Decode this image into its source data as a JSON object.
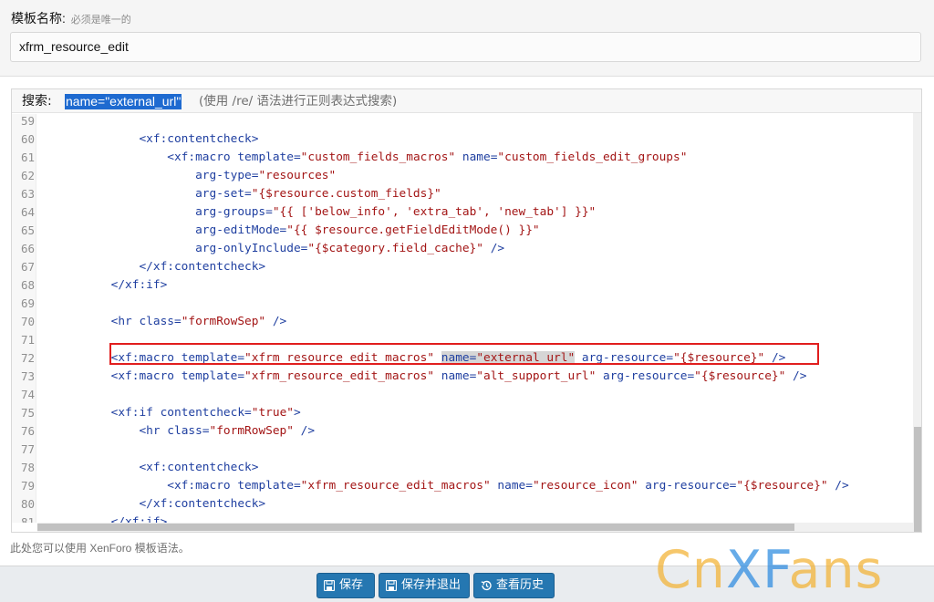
{
  "form": {
    "title_label": "模板名称:",
    "title_hint": "必须是唯一的",
    "title_value": "xfrm_resource_edit",
    "explain": "此处您可以使用 XenForo 模板语法。"
  },
  "editor": {
    "search_label": "搜索:",
    "search_value": "name=\"external_url\"",
    "search_hint": "(使用 /re/ 语法进行正则表达式搜索)",
    "partial_line": "82",
    "lines": [
      {
        "n": "59",
        "segs": []
      },
      {
        "n": "60",
        "segs": [
          {
            "c": "t",
            "v": "            <xf:contentcheck>"
          }
        ]
      },
      {
        "n": "61",
        "segs": [
          {
            "c": "t",
            "v": "                <xf:macro "
          },
          {
            "c": "a",
            "v": "template="
          },
          {
            "c": "s",
            "v": "\"custom_fields_macros\""
          },
          {
            "c": "a",
            "v": " name="
          },
          {
            "c": "s",
            "v": "\"custom_fields_edit_groups\""
          }
        ]
      },
      {
        "n": "62",
        "segs": [
          {
            "c": "a",
            "v": "                    arg-type="
          },
          {
            "c": "s",
            "v": "\"resources\""
          }
        ]
      },
      {
        "n": "63",
        "segs": [
          {
            "c": "a",
            "v": "                    arg-set="
          },
          {
            "c": "s",
            "v": "\"{$resource.custom_fields}\""
          }
        ]
      },
      {
        "n": "64",
        "segs": [
          {
            "c": "a",
            "v": "                    arg-groups="
          },
          {
            "c": "s",
            "v": "\"{{ ['below_info', 'extra_tab', 'new_tab'] }}\""
          }
        ]
      },
      {
        "n": "65",
        "segs": [
          {
            "c": "a",
            "v": "                    arg-editMode="
          },
          {
            "c": "s",
            "v": "\"{{ $resource.getFieldEditMode() }}\""
          }
        ]
      },
      {
        "n": "66",
        "segs": [
          {
            "c": "a",
            "v": "                    arg-onlyInclude="
          },
          {
            "c": "s",
            "v": "\"{$category.field_cache}\""
          },
          {
            "c": "t",
            "v": " />"
          }
        ]
      },
      {
        "n": "67",
        "segs": [
          {
            "c": "t",
            "v": "            </xf:contentcheck>"
          }
        ]
      },
      {
        "n": "68",
        "segs": [
          {
            "c": "t",
            "v": "        </xf:if>"
          }
        ]
      },
      {
        "n": "69",
        "segs": []
      },
      {
        "n": "70",
        "segs": [
          {
            "c": "t",
            "v": "        <hr "
          },
          {
            "c": "a",
            "v": "class="
          },
          {
            "c": "s",
            "v": "\"formRowSep\""
          },
          {
            "c": "t",
            "v": " />"
          }
        ]
      },
      {
        "n": "71",
        "segs": []
      },
      {
        "n": "72",
        "segs": [
          {
            "c": "t",
            "v": "        <xf:macro "
          },
          {
            "c": "a",
            "v": "template="
          },
          {
            "c": "s",
            "v": "\"xfrm_resource_edit_macros\""
          },
          {
            "c": "p",
            "v": " "
          },
          {
            "c": "a hl-match",
            "v": "name="
          },
          {
            "c": "s hl-match",
            "v": "\"external_url\""
          },
          {
            "c": "a",
            "v": " arg-resource="
          },
          {
            "c": "s",
            "v": "\"{$resource}\""
          },
          {
            "c": "t",
            "v": " />"
          }
        ]
      },
      {
        "n": "73",
        "segs": [
          {
            "c": "t",
            "v": "        <xf:macro "
          },
          {
            "c": "a",
            "v": "template="
          },
          {
            "c": "s",
            "v": "\"xfrm_resource_edit_macros\""
          },
          {
            "c": "a",
            "v": " name="
          },
          {
            "c": "s",
            "v": "\"alt_support_url\""
          },
          {
            "c": "a",
            "v": " arg-resource="
          },
          {
            "c": "s",
            "v": "\"{$resource}\""
          },
          {
            "c": "t",
            "v": " />"
          }
        ]
      },
      {
        "n": "74",
        "segs": []
      },
      {
        "n": "75",
        "segs": [
          {
            "c": "t",
            "v": "        <xf:if "
          },
          {
            "c": "a",
            "v": "contentcheck="
          },
          {
            "c": "s",
            "v": "\"true\""
          },
          {
            "c": "t",
            "v": ">"
          }
        ]
      },
      {
        "n": "76",
        "segs": [
          {
            "c": "t",
            "v": "            <hr "
          },
          {
            "c": "a",
            "v": "class="
          },
          {
            "c": "s",
            "v": "\"formRowSep\""
          },
          {
            "c": "t",
            "v": " />"
          }
        ]
      },
      {
        "n": "77",
        "segs": []
      },
      {
        "n": "78",
        "segs": [
          {
            "c": "t",
            "v": "            <xf:contentcheck>"
          }
        ]
      },
      {
        "n": "79",
        "segs": [
          {
            "c": "t",
            "v": "                <xf:macro "
          },
          {
            "c": "a",
            "v": "template="
          },
          {
            "c": "s",
            "v": "\"xfrm_resource_edit_macros\""
          },
          {
            "c": "a",
            "v": " name="
          },
          {
            "c": "s",
            "v": "\"resource_icon\""
          },
          {
            "c": "a",
            "v": " arg-resource="
          },
          {
            "c": "s",
            "v": "\"{$resource}\""
          },
          {
            "c": "t",
            "v": " />"
          }
        ]
      },
      {
        "n": "80",
        "segs": [
          {
            "c": "t",
            "v": "            </xf:contentcheck>"
          }
        ]
      },
      {
        "n": "81",
        "segs": [
          {
            "c": "t",
            "v": "        </xf:if>"
          }
        ]
      }
    ]
  },
  "buttons": {
    "save": "保存",
    "save_exit": "保存并退出",
    "history": "查看历史"
  },
  "icons": {
    "save": "floppy-disk-icon",
    "save_exit": "floppy-disk-exit-icon",
    "history": "history-icon"
  },
  "colors": {
    "primary_button": "#2577b1",
    "tag": "#1f3fa0",
    "string": "#a31515",
    "search_highlight": "#1e6ad0",
    "annotation_box": "#e11e1e"
  },
  "watermark": {
    "part1": "Cn",
    "part2": "XF",
    "part3": "ans"
  }
}
